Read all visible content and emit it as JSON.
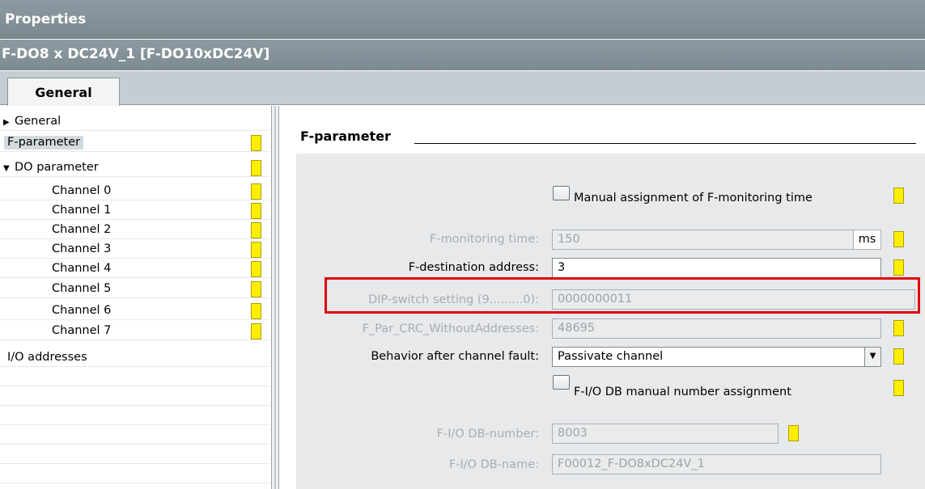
{
  "window": {
    "title": "Properties"
  },
  "object": {
    "name": "F-DO8 x DC24V_1 [F-DO10xDC24V]"
  },
  "tabs": [
    {
      "label": "General"
    }
  ],
  "nav": {
    "items": [
      {
        "label": "General",
        "expander": "▶",
        "flag": false
      },
      {
        "label": "F-parameter",
        "expander": "",
        "flag": true,
        "selected": true
      },
      {
        "label": "DO parameter",
        "expander": "▼",
        "flag": true
      },
      {
        "label": "Channel 0",
        "expander": "",
        "flag": true
      },
      {
        "label": "Channel 1",
        "expander": "",
        "flag": true
      },
      {
        "label": "Channel 2",
        "expander": "",
        "flag": true
      },
      {
        "label": "Channel 3",
        "expander": "",
        "flag": true
      },
      {
        "label": "Channel 4",
        "expander": "",
        "flag": true
      },
      {
        "label": "Channel 5",
        "expander": "",
        "flag": true
      },
      {
        "label": "Channel 6",
        "expander": "",
        "flag": true
      },
      {
        "label": "Channel 7",
        "expander": "",
        "flag": true
      },
      {
        "label": "I/O addresses",
        "expander": "",
        "flag": false
      }
    ]
  },
  "section": {
    "title": "F-parameter"
  },
  "form": {
    "manual_monitoring": {
      "label": "Manual assignment of F-monitoring time",
      "checked": false
    },
    "monitoring_time": {
      "label": "F-monitoring time:",
      "value": "150",
      "unit": "ms"
    },
    "dest_address": {
      "label": "F-destination address:",
      "value": "3"
    },
    "dip_switch": {
      "label": "DIP-switch setting (9.........0):",
      "value": "0000000011"
    },
    "crc": {
      "label": "F_Par_CRC_WithoutAddresses:",
      "value": "48695"
    },
    "behavior": {
      "label": "Behavior after channel fault:",
      "value": "Passivate channel"
    },
    "manual_db": {
      "label": "F-I/O DB manual number assignment",
      "checked": false
    },
    "db_number": {
      "label": "F-I/O DB-number:",
      "value": "8003"
    },
    "db_name": {
      "label": "F-I/O DB-name:",
      "value": "F00012_F-DO8xDC24V_1"
    }
  },
  "colors": {
    "flag": "#ffee00",
    "highlight": "#e1000f",
    "title_bar": "#7c8991"
  }
}
